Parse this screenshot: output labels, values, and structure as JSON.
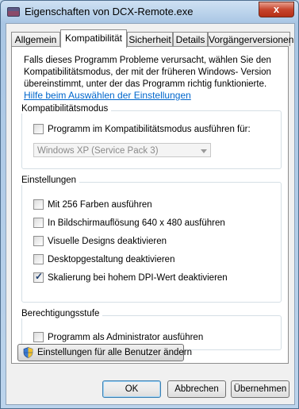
{
  "window": {
    "title": "Eigenschaften von DCX-Remote.exe",
    "close_label": "x"
  },
  "tabs": [
    {
      "label": "Allgemein",
      "active": false
    },
    {
      "label": "Kompatibilität",
      "active": true
    },
    {
      "label": "Sicherheit",
      "active": false
    },
    {
      "label": "Details",
      "active": false
    },
    {
      "label": "Vorgängerversionen",
      "active": false
    }
  ],
  "intro": {
    "line1": "Falls dieses Programm Probleme verursacht, wählen Sie den",
    "line2": "Kompatibilitätsmodus, der mit der früheren Windows- Version",
    "line3": "übereinstimmt, unter der das Programm richtig funktionierte."
  },
  "help_link": "Hilfe beim Auswählen der Einstellungen",
  "compat_mode": {
    "title": "Kompatibilitätsmodus",
    "checkbox_label": "Programm im Kompatibilitätsmodus ausführen für:",
    "checked": false,
    "dropdown_value": "Windows XP (Service Pack 3)"
  },
  "settings": {
    "title": "Einstellungen",
    "items": [
      {
        "label": "Mit 256 Farben ausführen",
        "checked": false
      },
      {
        "label": "In Bildschirmauflösung 640 x 480 ausführen",
        "checked": false
      },
      {
        "label": "Visuelle Designs deaktivieren",
        "checked": false
      },
      {
        "label": "Desktopgestaltung deaktivieren",
        "checked": false
      },
      {
        "label": "Skalierung bei hohem DPI-Wert deaktivieren",
        "checked": true
      }
    ]
  },
  "privilege": {
    "title": "Berechtigungsstufe",
    "checkbox_label": "Programm als Administrator ausführen",
    "checked": false
  },
  "all_users_button": "Einstellungen für alle Benutzer ändern",
  "buttons": {
    "ok": "OK",
    "cancel": "Abbrechen",
    "apply": "Übernehmen"
  }
}
